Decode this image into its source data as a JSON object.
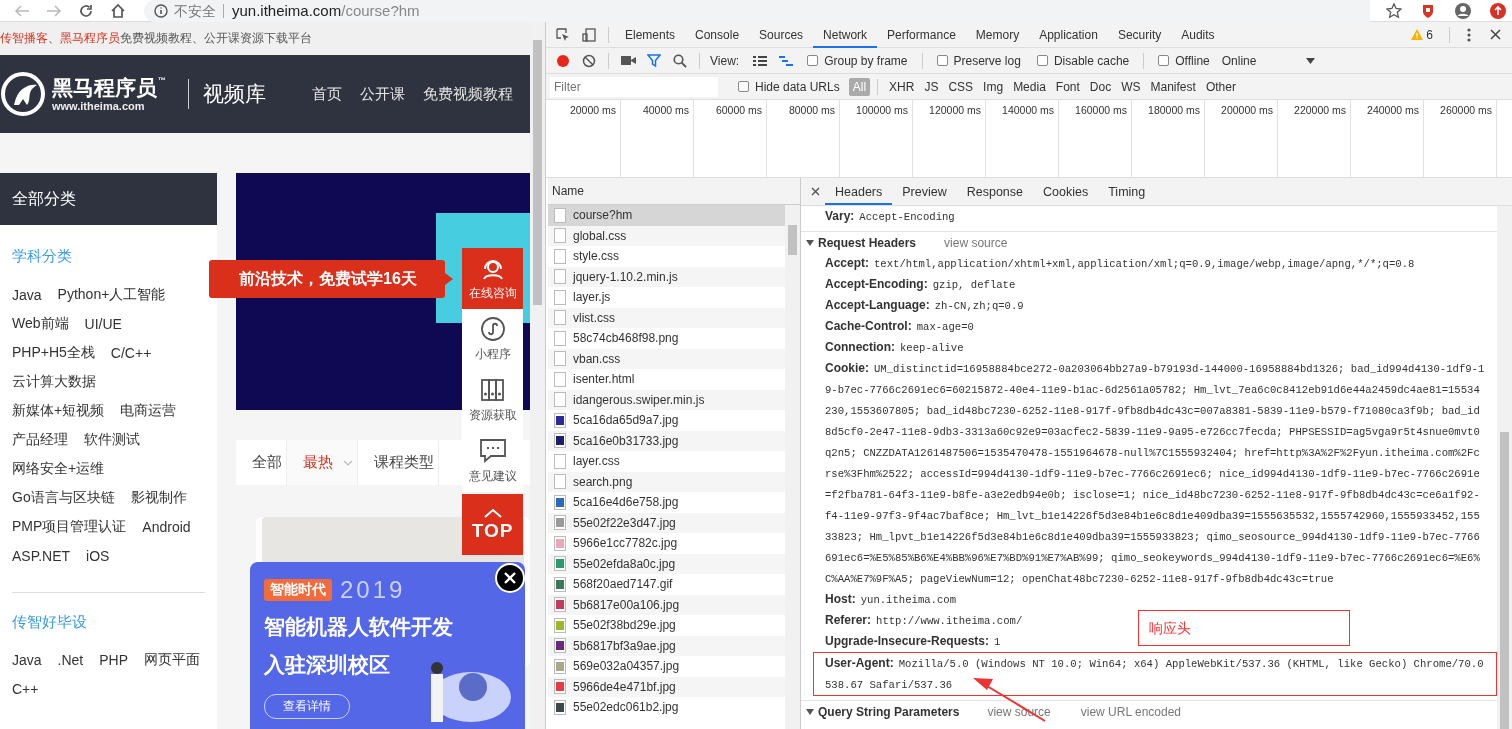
{
  "browser": {
    "security_label": "不安全",
    "url_host": "yun.itheima.com",
    "url_path": "/course?hm"
  },
  "site": {
    "notice": [
      {
        "text": "传智播客",
        "highlight": true
      },
      {
        "text": "、",
        "highlight": false
      },
      {
        "text": "黑马程序员",
        "highlight": true
      },
      {
        "text": "免费视频教程、公开课资源下载平台",
        "highlight": false
      }
    ],
    "logo": {
      "name": "黑马程序员",
      "tm": "™",
      "domain": "www.itheima.com"
    },
    "section_title": "视频库",
    "nav": [
      "首页",
      "公开课",
      "免费视频教程"
    ],
    "category_header": "全部分类",
    "groups": [
      {
        "title": "学科分类",
        "rows": [
          [
            "Java",
            "Python+人工智能"
          ],
          [
            "Web前端",
            "UI/UE"
          ],
          [
            "PHP+H5全栈",
            "C/C++"
          ],
          [
            "云计算大数据"
          ],
          [
            "新媒体+短视频",
            "电商运营"
          ],
          [
            "产品经理",
            "软件测试"
          ],
          [
            "网络安全+运维"
          ],
          [
            "Go语言与区块链",
            "影视制作"
          ],
          [
            "PMP项目管理认证",
            "Android"
          ],
          [
            "ASP.NET",
            "iOS"
          ]
        ]
      },
      {
        "title": "传智好毕设",
        "rows": [
          [
            "Java",
            ".Net",
            "PHP",
            "网页平面"
          ],
          [
            "C++"
          ]
        ]
      }
    ],
    "promo_tip": "前沿技术，免费试学16天",
    "float_menu": [
      {
        "kind": "headset",
        "label": "在线咨询",
        "highlight": true
      },
      {
        "kind": "miniapp",
        "label": "小程序",
        "highlight": false
      },
      {
        "kind": "binders",
        "label": "资源获取",
        "highlight": false
      },
      {
        "kind": "chat",
        "label": "意见建议",
        "highlight": false
      }
    ],
    "top_button": "TOP",
    "sort_tabs": [
      {
        "label": "全部",
        "selected": false,
        "dropdown": false
      },
      {
        "label": "最热",
        "selected": true,
        "dropdown": true
      },
      {
        "label": "课程类型",
        "selected": false,
        "dropdown": false
      }
    ],
    "ad": {
      "tag": "智能时代",
      "year": "2019",
      "headline": [
        "智能机器人软件开发",
        "入驻深圳校区"
      ],
      "button": "查看详情"
    }
  },
  "devtools": {
    "tabs": [
      {
        "label": "Elements",
        "selected": false
      },
      {
        "label": "Console",
        "selected": false
      },
      {
        "label": "Sources",
        "selected": false
      },
      {
        "label": "Network",
        "selected": true
      },
      {
        "label": "Performance",
        "selected": false
      },
      {
        "label": "Memory",
        "selected": false
      },
      {
        "label": "Application",
        "selected": false
      },
      {
        "label": "Security",
        "selected": false
      },
      {
        "label": "Audits",
        "selected": false
      }
    ],
    "warning_count": "6",
    "view_label": "View:",
    "options": [
      {
        "label": "Group by frame",
        "checked": false
      },
      {
        "label": "Preserve log",
        "checked": false
      },
      {
        "label": "Disable cache",
        "checked": false
      },
      {
        "label": "Offline",
        "checked": false
      }
    ],
    "throttle": "Online",
    "filter_placeholder": "Filter",
    "hide_data_urls": {
      "label": "Hide data URLs",
      "checked": false
    },
    "types": [
      {
        "label": "All",
        "selected": true
      },
      {
        "label": "XHR",
        "selected": false
      },
      {
        "label": "JS",
        "selected": false
      },
      {
        "label": "CSS",
        "selected": false
      },
      {
        "label": "Img",
        "selected": false
      },
      {
        "label": "Media",
        "selected": false
      },
      {
        "label": "Font",
        "selected": false
      },
      {
        "label": "Doc",
        "selected": false
      },
      {
        "label": "WS",
        "selected": false
      },
      {
        "label": "Manifest",
        "selected": false
      },
      {
        "label": "Other",
        "selected": false
      }
    ],
    "timeline_ticks": [
      "20000 ms",
      "40000 ms",
      "60000 ms",
      "80000 ms",
      "100000 ms",
      "120000 ms",
      "140000 ms",
      "160000 ms",
      "180000 ms",
      "200000 ms",
      "220000 ms",
      "240000 ms",
      "260000 ms"
    ],
    "name_column": "Name",
    "requests": [
      {
        "name": "course?hm",
        "kind": "document",
        "selected": true
      },
      {
        "name": "global.css",
        "kind": "document",
        "selected": false
      },
      {
        "name": "style.css",
        "kind": "document",
        "selected": false
      },
      {
        "name": "jquery-1.10.2.min.js",
        "kind": "document",
        "selected": false
      },
      {
        "name": "layer.js",
        "kind": "document",
        "selected": false
      },
      {
        "name": "vlist.css",
        "kind": "document",
        "selected": false
      },
      {
        "name": "58c74cb468f98.png",
        "kind": "document",
        "selected": false
      },
      {
        "name": "vban.css",
        "kind": "document",
        "selected": false
      },
      {
        "name": "isenter.html",
        "kind": "document",
        "selected": false
      },
      {
        "name": "idangerous.swiper.min.js",
        "kind": "document",
        "selected": false
      },
      {
        "name": "5ca16da65d9a7.jpg",
        "kind": "image",
        "color": "#2a2a9a",
        "selected": false
      },
      {
        "name": "5ca16e0b31733.jpg",
        "kind": "image",
        "color": "#1c1c6a",
        "selected": false
      },
      {
        "name": "layer.css",
        "kind": "document",
        "selected": false
      },
      {
        "name": "search.png",
        "kind": "document",
        "selected": false
      },
      {
        "name": "5ca16e4d6e758.jpg",
        "kind": "image",
        "color": "#2a6ab8",
        "selected": false
      },
      {
        "name": "55e02f22e3d47.jpg",
        "kind": "image",
        "color": "#9a9a9a",
        "selected": false
      },
      {
        "name": "5966e1cc7782c.jpg",
        "kind": "image",
        "color": "#e8a8b8",
        "selected": false
      },
      {
        "name": "55e02efda8a0c.jpg",
        "kind": "image",
        "color": "#2a9a6a",
        "selected": false
      },
      {
        "name": "568f20aed7147.gif",
        "kind": "image",
        "color": "#3a7a5a",
        "selected": false
      },
      {
        "name": "5b6817e00a106.jpg",
        "kind": "image",
        "color": "#c83a5a",
        "selected": false
      },
      {
        "name": "55e02f38bd29e.jpg",
        "kind": "image",
        "color": "#9ab82a",
        "selected": false
      },
      {
        "name": "5b6817bf3a9ae.jpg",
        "kind": "image",
        "color": "#6a2a7a",
        "selected": false
      },
      {
        "name": "569e032a04357.jpg",
        "kind": "image",
        "color": "#a8a88a",
        "selected": false
      },
      {
        "name": "5966de4e471bf.jpg",
        "kind": "image",
        "color": "#e83a4a",
        "selected": false
      },
      {
        "name": "55e02edc061b2.jpg",
        "kind": "image",
        "color": "#3a4a4a",
        "selected": false
      }
    ],
    "detail_tabs": [
      {
        "label": "Headers",
        "selected": true
      },
      {
        "label": "Preview",
        "selected": false
      },
      {
        "label": "Response",
        "selected": false
      },
      {
        "label": "Cookies",
        "selected": false
      },
      {
        "label": "Timing",
        "selected": false
      }
    ],
    "response_tail": [
      {
        "name": "Vary:",
        "lines": [
          "Accept-Encoding"
        ],
        "marked": false
      }
    ],
    "sections": [
      {
        "title": "Request Headers",
        "expanded": true,
        "links": [
          "view source"
        ],
        "headers": [
          {
            "name": "Accept:",
            "lines": [
              "text/html,application/xhtml+xml,application/xml;q=0.9,image/webp,image/apng,*/*;q=0.8"
            ],
            "marked": false
          },
          {
            "name": "Accept-Encoding:",
            "lines": [
              "gzip, deflate"
            ],
            "marked": false
          },
          {
            "name": "Accept-Language:",
            "lines": [
              "zh-CN,zh;q=0.9"
            ],
            "marked": false
          },
          {
            "name": "Cache-Control:",
            "lines": [
              "max-age=0"
            ],
            "marked": false
          },
          {
            "name": "Connection:",
            "lines": [
              "keep-alive"
            ],
            "marked": false
          },
          {
            "name": "Cookie:",
            "lines": [
              "UM_distinctid=16958884bce272-0a203064bb27a9-b79193d-144000-16958884bd1326; bad_id994d4130-1df9-1",
              "9-b7ec-7766c2691ec6=60215872-40e4-11e9-b1ac-6d2561a05782; Hm_lvt_7ea6c0c8412eb91d6e44a2459dc4ae81=15534",
              "230,1553607805; bad_id48bc7230-6252-11e8-917f-9fb8db4dc43c=007a8381-5839-11e9-b579-f71080ca3f9b; bad_id",
              "8d5cf0-2e47-11e8-9db3-3313a60c92e9=03acfec2-5839-11e9-9a95-e726cc7fecda; PHPSESSID=ag5vga9r5t4snue0mvt0",
              "q2n5; CNZZDATA1261487506=1535470478-1551964678-null%7C1555932404; href=http%3A%2F%2Fyun.itheima.com%2Fc",
              "rse%3Fhm%2522; accessId=994d4130-1df9-11e9-b7ec-7766c2691ec6; nice_id994d4130-1df9-11e9-b7ec-7766c2691e",
              "=f2fba781-64f3-11e9-b8fe-a3e2edb94e0b; isclose=1; nice_id48bc7230-6252-11e8-917f-9fb8db4dc43c=ce6a1f92-",
              "f4-11e9-97f3-9f4ac7baf8ce; Hm_lvt_b1e14226f5d3e84b1e6c8d1e409dba39=1555635532,1555742960,1555933452,155",
              "33823; Hm_lpvt_b1e14226f5d3e84b1e6c8d1e409dba39=1555933823; qimo_seosource_994d4130-1df9-11e9-b7ec-7766",
              "691ec6=%E5%85%B6%E4%BB%96%E7%BD%91%E7%AB%99; qimo_seokeywords_994d4130-1df9-11e9-b7ec-7766c2691ec6=%E6%",
              "C%AA%E7%9F%A5; pageViewNum=12; openChat48bc7230-6252-11e8-917f-9fb8db4dc43c=true"
            ],
            "marked": false
          },
          {
            "name": "Host:",
            "lines": [
              "yun.itheima.com"
            ],
            "marked": false
          },
          {
            "name": "Referer:",
            "lines": [
              "http://www.itheima.com/"
            ],
            "marked": false
          },
          {
            "name": "Upgrade-Insecure-Requests:",
            "lines": [
              "1"
            ],
            "marked": false
          },
          {
            "name": "User-Agent:",
            "lines": [
              "Mozilla/5.0 (Windows NT 10.0; Win64; x64) AppleWebKit/537.36 (KHTML, like Gecko) Chrome/70.0",
              "538.67 Safari/537.36"
            ],
            "marked": true
          }
        ]
      },
      {
        "title": "Query String Parameters",
        "expanded": true,
        "links": [
          "view source",
          "view URL encoded"
        ]
      }
    ],
    "annotation": "响应头"
  }
}
